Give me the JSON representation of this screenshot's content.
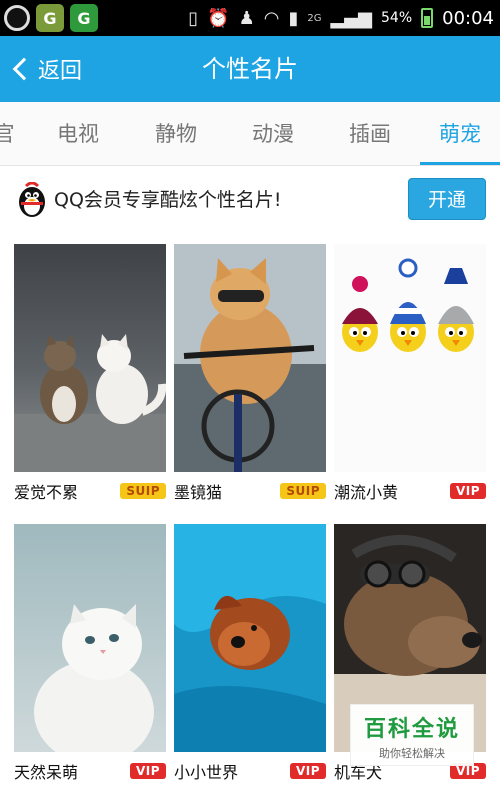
{
  "status_bar": {
    "signal_type": "2G",
    "battery": "54%",
    "time": "00:04"
  },
  "header": {
    "back_label": "返回",
    "title": "个性名片"
  },
  "tabs": [
    "官",
    "电视",
    "静物",
    "动漫",
    "插画",
    "萌宠"
  ],
  "active_tab": "萌宠",
  "promo": {
    "text": "QQ会员专享酷炫个性名片!",
    "button_label": "开通"
  },
  "cards": [
    {
      "caption": "爱觉不累",
      "badge": "SUIP"
    },
    {
      "caption": "墨镜猫",
      "badge": "SUIP"
    },
    {
      "caption": "潮流小黄",
      "badge": "VIP"
    },
    {
      "caption": "天然呆萌",
      "badge": "VIP"
    },
    {
      "caption": "小小世界",
      "badge": "VIP"
    },
    {
      "caption": "机车犬",
      "badge": "VIP"
    }
  ],
  "watermark": {
    "title": "百科全说",
    "subtitle": "助你轻松解决"
  },
  "colors": {
    "accent": "#1ea4e3",
    "suip_badge": "#f5c518",
    "vip_badge": "#e12a2a"
  }
}
